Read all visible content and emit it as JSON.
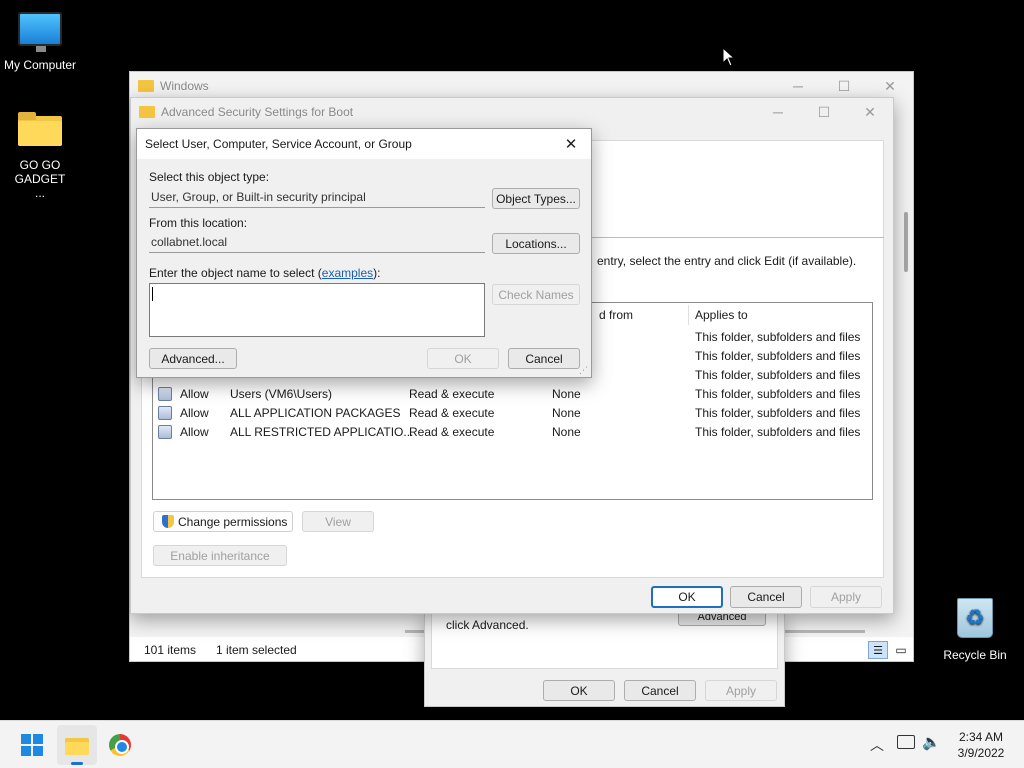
{
  "desktop": {
    "icons": [
      {
        "label": "My Computer"
      },
      {
        "label": "GO GO GADGET ..."
      },
      {
        "label": "Recycle Bin"
      }
    ]
  },
  "explorer": {
    "title": "Windows",
    "status_items": "101 items",
    "status_selected": "1 item selected"
  },
  "props_dialog": {
    "hint": "click Advanced.",
    "advanced_label": "Advanced",
    "ok": "OK",
    "cancel": "Cancel",
    "apply": "Apply"
  },
  "advanced_security": {
    "title": "Advanced Security Settings for Boot",
    "instruction": "entry, select the entry and click Edit (if available).",
    "columns": {
      "inherited_from": "d from",
      "applies_to": "Applies to"
    },
    "rows": [
      {
        "type": "",
        "principal": "",
        "access": "",
        "inherited": "",
        "applies": "This folder, subfolders and files"
      },
      {
        "type": "",
        "principal": "",
        "access": "",
        "inherited": "",
        "applies": "This folder, subfolders and files"
      },
      {
        "type": "",
        "principal": "",
        "access": "",
        "inherited": "",
        "applies": "This folder, subfolders and files"
      },
      {
        "type": "Allow",
        "principal": "Users (VM6\\Users)",
        "access": "Read & execute",
        "inherited": "None",
        "applies": "This folder, subfolders and files"
      },
      {
        "type": "Allow",
        "principal": "ALL APPLICATION PACKAGES",
        "access": "Read & execute",
        "inherited": "None",
        "applies": "This folder, subfolders and files"
      },
      {
        "type": "Allow",
        "principal": "ALL RESTRICTED APPLICATIO...",
        "access": "Read & execute",
        "inherited": "None",
        "applies": "This folder, subfolders and files"
      }
    ],
    "change_permissions": "Change permissions",
    "view": "View",
    "enable_inheritance": "Enable inheritance",
    "ok": "OK",
    "cancel": "Cancel",
    "apply": "Apply"
  },
  "select_dialog": {
    "title": "Select User, Computer, Service Account, or Group",
    "object_type_label": "Select this object type:",
    "object_type_value": "User, Group, or Built-in security principal",
    "object_types_button": "Object Types...",
    "location_label": "From this location:",
    "location_value": "collabnet.local",
    "locations_button": "Locations...",
    "name_label": "Enter the object name to select (",
    "name_label_link": "examples",
    "name_label_end": "):",
    "name_value": "",
    "check_names": "Check Names",
    "advanced": "Advanced...",
    "ok": "OK",
    "cancel": "Cancel"
  },
  "taskbar": {
    "time": "2:34 AM",
    "date": "3/9/2022"
  }
}
